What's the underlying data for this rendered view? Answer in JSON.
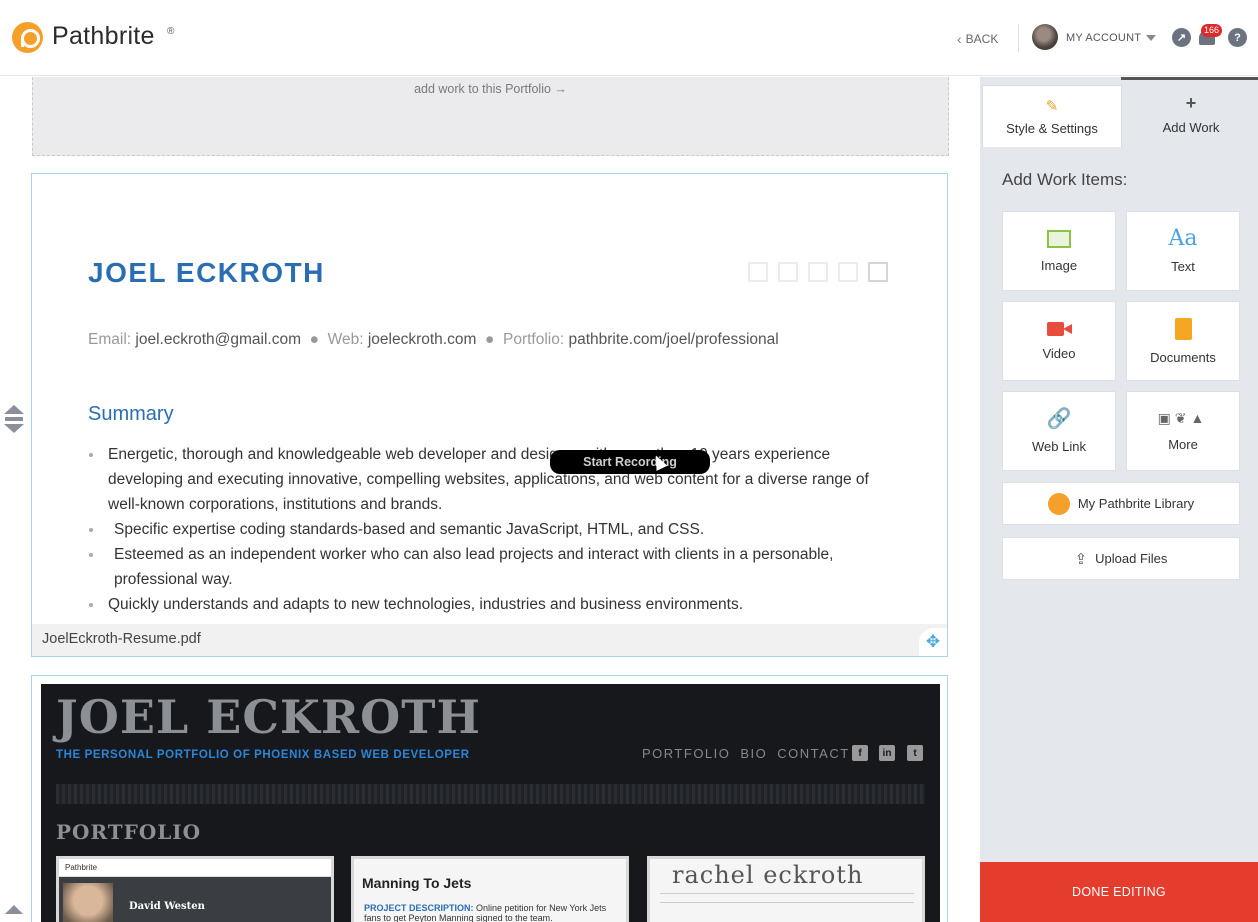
{
  "header": {
    "logo_text": "Pathbrite",
    "logo_reg": "®",
    "back_label": "BACK",
    "account_label": "MY ACCOUNT",
    "notification_count": "166"
  },
  "main": {
    "drop_hint": "add work to this Portfolio →",
    "resume": {
      "name": "JOEL ECKROTH",
      "contact": {
        "email_label": "Email:",
        "email": "joel.eckroth@gmail.com",
        "web_label": "Web:",
        "web": "joeleckroth.com",
        "portfolio_label": "Portfolio:",
        "portfolio": "pathbrite.com/joel/professional"
      },
      "summary_heading": "Summary",
      "bullets": [
        "Energetic, thorough and knowledgeable web developer and designer with more than 10 years experience developing and executing innovative, compelling websites, applications, and web content for a diverse range of well-known corporations, institutions and brands.",
        "Specific expertise coding standards-based and semantic JavaScript, HTML, and CSS.",
        "Esteemed as an independent worker who can also lead projects and interact with clients in a personable, professional way.",
        "Quickly understands and adapts to new technologies, industries and business environments."
      ],
      "caption": "JoelEckroth-Resume.pdf"
    },
    "tooltip": "Start Recording",
    "website": {
      "name": "JOEL ECKROTH",
      "tagline": "THE PERSONAL PORTFOLIO OF PHOENIX BASED WEB DEVELOPER",
      "nav": [
        "PORTFOLIO",
        "BIO",
        "CONTACT"
      ],
      "section": "PORTFOLIO",
      "thumb1_brand": "Pathbrite",
      "thumb1_person": "David Westen",
      "thumb2_title": "Manning To Jets",
      "thumb2_desc_label": "PROJECT DESCRIPTION:",
      "thumb2_desc": "Online petition for New York Jets fans to get Peyton Manning signed to the team.",
      "thumb3_name": "rachel eckroth"
    }
  },
  "sidebar": {
    "tab_style": "Style & Settings",
    "tab_add": "Add Work",
    "add_title": "Add Work Items:",
    "tiles": {
      "image": "Image",
      "text": "Text",
      "video": "Video",
      "documents": "Documents",
      "weblink": "Web Link",
      "more": "More"
    },
    "text_glyph": "Aa",
    "library": "My Pathbrite Library",
    "upload": "Upload Files",
    "done": "DONE EDITING"
  }
}
